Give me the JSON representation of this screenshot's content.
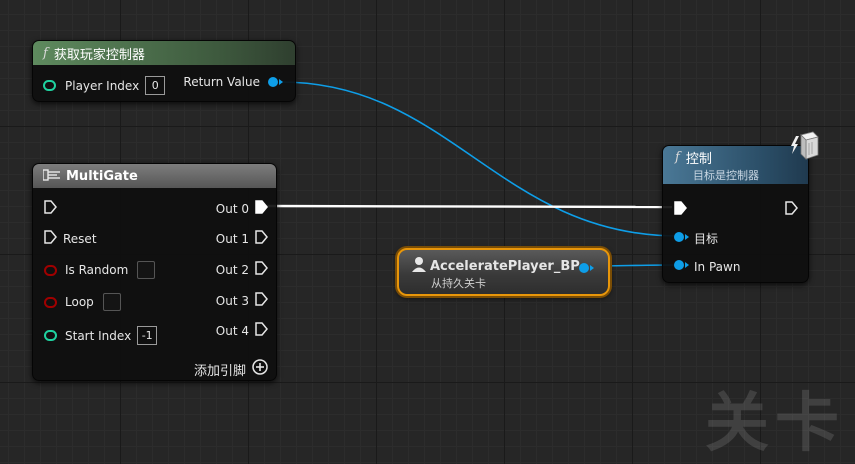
{
  "nodes": {
    "get_player_controller": {
      "title": "获取玩家控制器",
      "player_index_label": "Player Index",
      "player_index_value": "0",
      "return_label": "Return Value"
    },
    "multigate": {
      "title": "MultiGate",
      "reset_label": "Reset",
      "is_random_label": "Is Random",
      "loop_label": "Loop",
      "start_index_label": "Start Index",
      "start_index_value": "-1",
      "outputs": [
        "Out 0",
        "Out 1",
        "Out 2",
        "Out 3",
        "Out 4"
      ],
      "add_pin_label": "添加引脚"
    },
    "possess": {
      "title": "控制",
      "subtitle": "目标是控制器",
      "target_label": "目标",
      "pawn_label": "In Pawn"
    },
    "variable": {
      "title": "AcceleratePlayer_BP",
      "subtitle": "从持久关卡"
    }
  },
  "watermark": "关卡",
  "colors": {
    "object_pin": "#0e9ee8",
    "int_pin": "#1fd2a0",
    "bool_pin": "#8c0000",
    "selected_outline": "#e8960a",
    "exec_wire": "#ffffff"
  }
}
